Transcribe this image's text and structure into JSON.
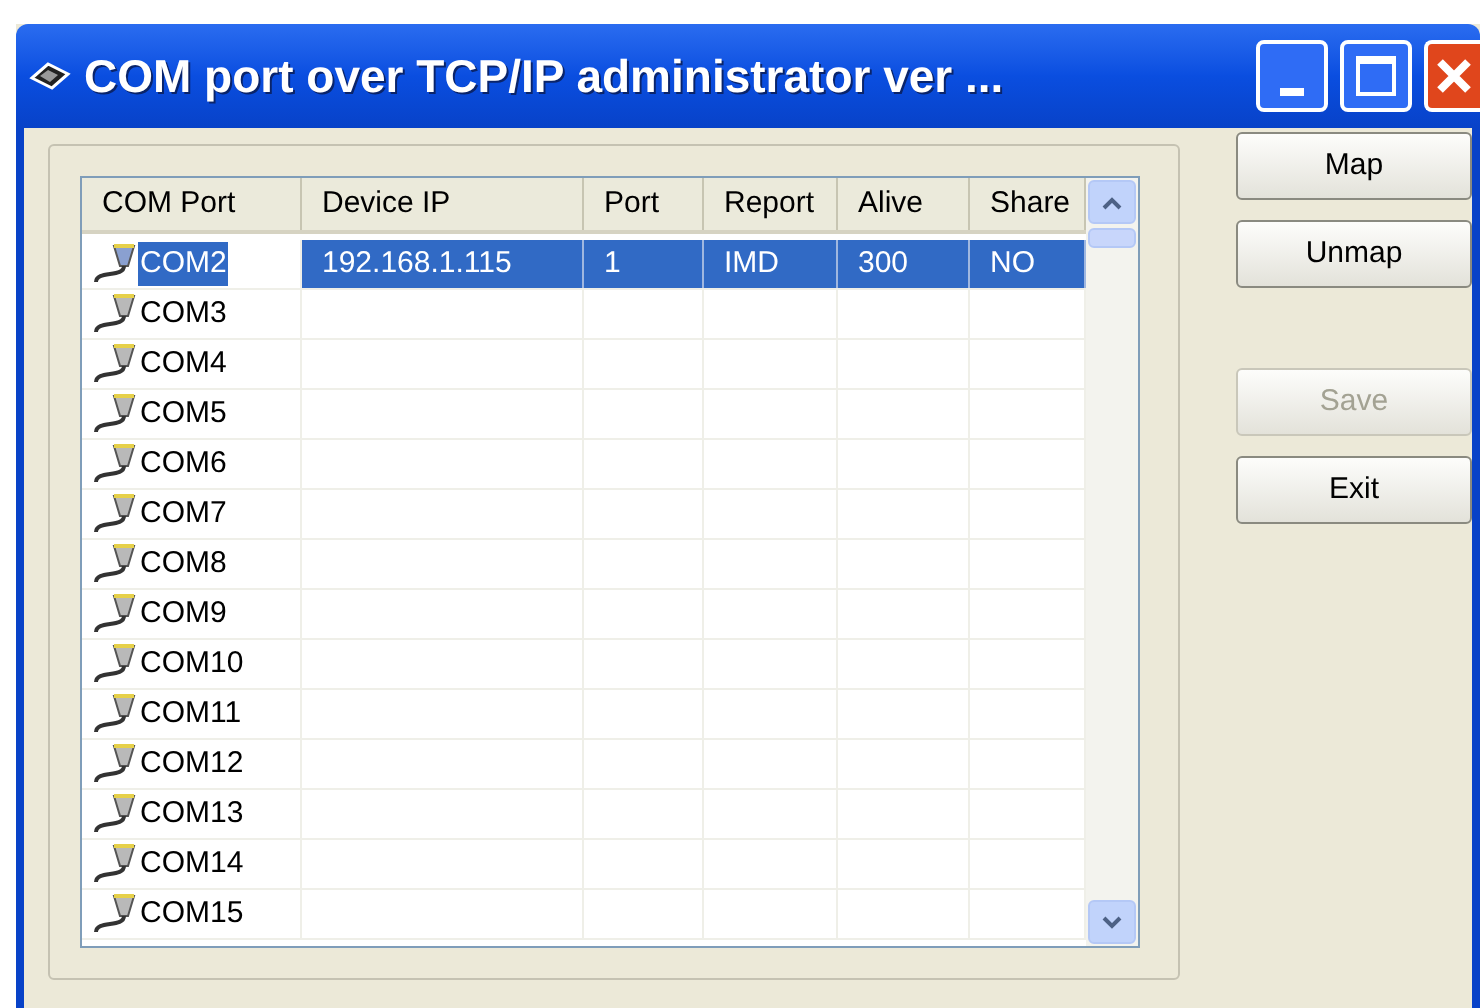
{
  "window": {
    "title": "COM port over TCP/IP administrator ver ..."
  },
  "table": {
    "columns": [
      "COM Port",
      "Device IP",
      "Port",
      "Report",
      "Alive",
      "Share"
    ],
    "rows": [
      {
        "com_port": "COM2",
        "device_ip": "192.168.1.115",
        "port": "1",
        "report": "IMD",
        "alive": "300",
        "share": "NO",
        "selected": true
      },
      {
        "com_port": "COM3",
        "selected": false
      },
      {
        "com_port": "COM4",
        "selected": false
      },
      {
        "com_port": "COM5",
        "selected": false
      },
      {
        "com_port": "COM6",
        "selected": false
      },
      {
        "com_port": "COM7",
        "selected": false
      },
      {
        "com_port": "COM8",
        "selected": false
      },
      {
        "com_port": "COM9",
        "selected": false
      },
      {
        "com_port": "COM10",
        "selected": false
      },
      {
        "com_port": "COM11",
        "selected": false
      },
      {
        "com_port": "COM12",
        "selected": false
      },
      {
        "com_port": "COM13",
        "selected": false
      },
      {
        "com_port": "COM14",
        "selected": false
      },
      {
        "com_port": "COM15",
        "selected": false
      }
    ]
  },
  "buttons": [
    {
      "label": "Map",
      "disabled": false
    },
    {
      "label": "Unmap",
      "disabled": false
    },
    {
      "label": "Save",
      "disabled": true
    },
    {
      "label": "Exit",
      "disabled": false
    }
  ]
}
